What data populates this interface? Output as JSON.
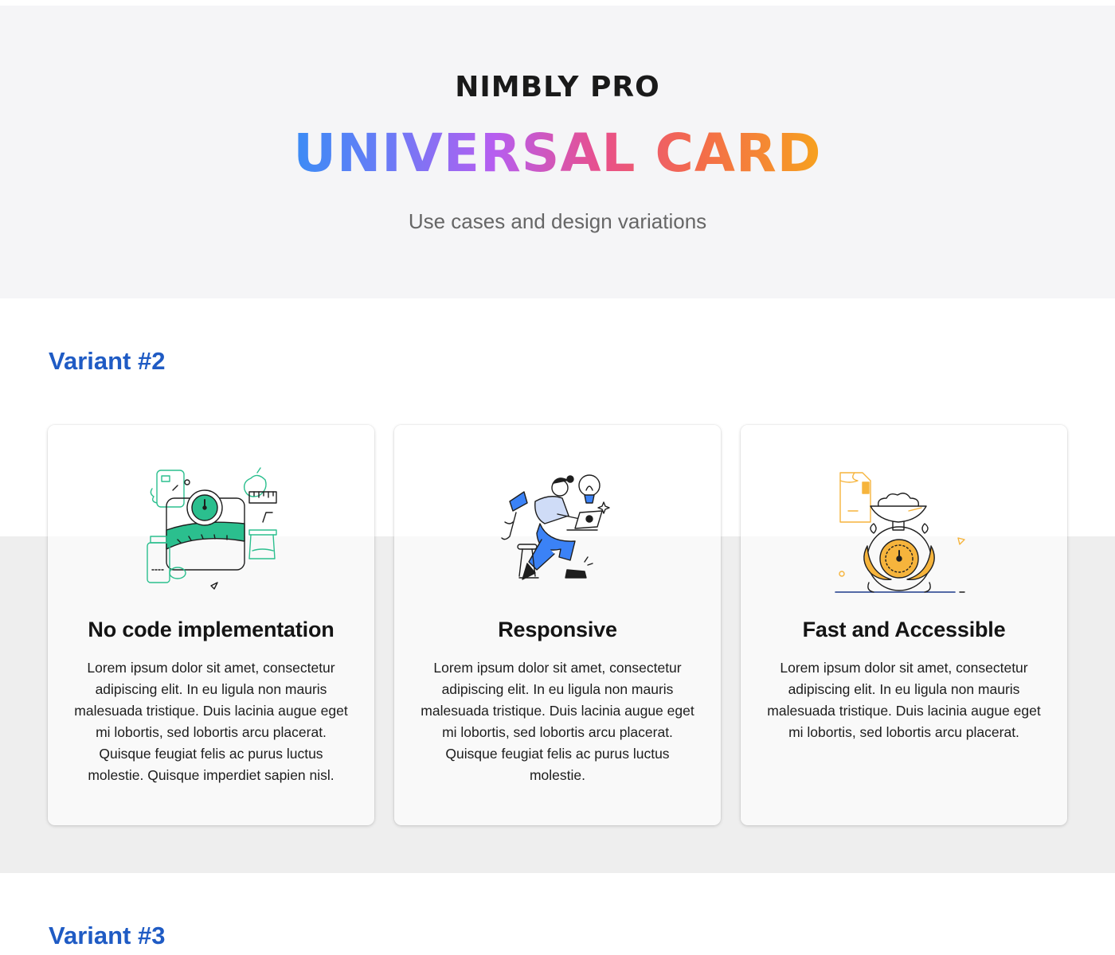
{
  "hero": {
    "brand": "NIMBLY PRO",
    "title": "UNIVERSAL CARD",
    "subtitle": "Use cases and design variations"
  },
  "sections": [
    {
      "heading": "Variant #2"
    },
    {
      "heading": "Variant #3"
    }
  ],
  "cards": [
    {
      "title": "No code implementation",
      "body": "Lorem ipsum dolor sit amet, consectetur adipiscing elit. In eu ligula non mauris malesuada tristique. Duis lacinia augue eget mi lobortis, sed lobortis arcu placerat. Quisque feugiat felis ac purus luctus molestie. Quisque imperdiet sapien nisl.",
      "icon": "fitness-scale-illustration",
      "accent": "#2bbf8e"
    },
    {
      "title": "Responsive",
      "body": "Lorem ipsum dolor sit amet, consectetur adipiscing elit. In eu ligula non mauris malesuada tristique. Duis lacinia augue eget mi lobortis, sed lobortis arcu placerat. Quisque feugiat felis ac purus luctus molestie.",
      "icon": "person-laptop-illustration",
      "accent": "#3b82f6"
    },
    {
      "title": "Fast and Accessible",
      "body": "Lorem ipsum dolor sit amet, consectetur adipiscing elit. In eu ligula non mauris malesuada tristique. Duis lacinia augue eget mi lobortis, sed lobortis arcu placerat.",
      "icon": "kitchen-scale-illustration",
      "accent": "#f6b43c"
    }
  ],
  "colors": {
    "hero_bg": "#f5f5f7",
    "band_bg": "#eeeeee",
    "heading_blue": "#1f5bc4"
  }
}
